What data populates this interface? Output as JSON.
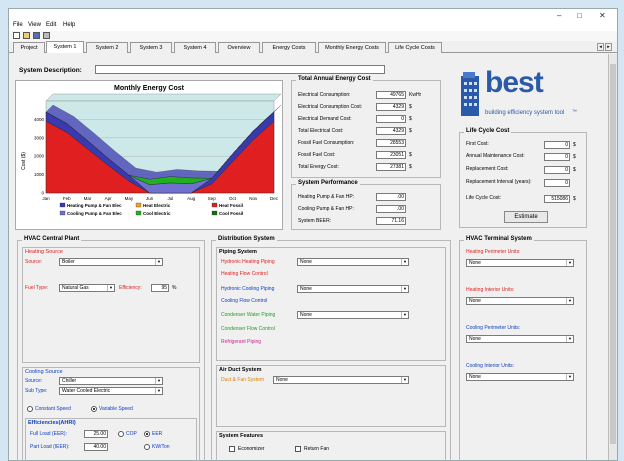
{
  "window": {
    "controls": [
      "–",
      "□",
      "✕"
    ]
  },
  "menu": [
    "File",
    "View",
    "Edit",
    "Help"
  ],
  "tabs": [
    "Project",
    "System 1",
    "System 2",
    "System 3",
    "System 4",
    "Overview",
    "Energy Costs",
    "Monthly Energy Costs",
    "Life Cycle Costs"
  ],
  "system_description_label": "System Description:",
  "chart": {
    "title": "Monthly Energy Cost",
    "ylabel": "Cost ($)",
    "yticks": [
      "4000",
      "3000",
      "2000",
      "1000",
      "0"
    ],
    "legend": [
      "Heating Pump & Fan Elec",
      "Heat Electric",
      "Heat Fossil",
      "Cooling Pump & Fan Elec",
      "Cool Electric",
      "Cool Fossil"
    ]
  },
  "chart_data": {
    "type": "area",
    "title": "Monthly Energy Cost",
    "ylabel": "Cost ($)",
    "ylim": [
      0,
      5000
    ],
    "categories": [
      "Jan",
      "Feb",
      "Mar",
      "Apr",
      "May",
      "Jun",
      "Jul",
      "Aug",
      "Sep",
      "Oct",
      "Nov",
      "Dec"
    ],
    "series": [
      {
        "name": "Heat Fossil",
        "values": [
          3900,
          3300,
          2400,
          1500,
          650,
          0,
          0,
          0,
          500,
          1700,
          2900,
          3900
        ],
        "color": "#e02020"
      },
      {
        "name": "Heating Pump & Fan Elec",
        "values": [
          500,
          480,
          450,
          380,
          320,
          0,
          0,
          0,
          300,
          420,
          470,
          500
        ],
        "color": "#3a3ab0"
      },
      {
        "name": "Cooling Pump & Fan Elec",
        "values": [
          0,
          0,
          0,
          0,
          0,
          450,
          550,
          500,
          0,
          0,
          0,
          0
        ],
        "color": "#7070d0"
      },
      {
        "name": "Cool Electric",
        "values": [
          0,
          0,
          0,
          0,
          0,
          300,
          350,
          320,
          0,
          0,
          0,
          0
        ],
        "color": "#20b020"
      }
    ],
    "backdrop_color": "#cde8e8"
  },
  "annual": {
    "title": "Total Annual Energy Cost",
    "rows": [
      {
        "label": "Electrical Consumption:",
        "value": "49765",
        "unit": "KwHr"
      },
      {
        "label": "Electrical Consumption Cost:",
        "value": "4329",
        "unit": "$"
      },
      {
        "label": "Electrical Demand Cost:",
        "value": "0",
        "unit": "$"
      },
      {
        "label": "Total Electrical Cost:",
        "value": "4329",
        "unit": "$"
      },
      {
        "label": "Fossil Fuel Consumption:",
        "value": "28553",
        "unit": ""
      },
      {
        "label": "Fossil Fuel Cost:",
        "value": "23051",
        "unit": "$"
      },
      {
        "label": "Total Energy Cost:",
        "value": "27381",
        "unit": "$"
      }
    ]
  },
  "performance": {
    "title": "System Performance",
    "rows": [
      {
        "label": "Heating Pump & Fan HP:",
        "value": ".00"
      },
      {
        "label": "Cooling Pump & Fan HP:",
        "value": ".00"
      },
      {
        "label": "System BEER:",
        "value": "71.16"
      }
    ]
  },
  "logo": {
    "word": "best",
    "tagline": "building efficiency system tool",
    "tm": "™"
  },
  "lcc": {
    "title": "Life Cycle Cost",
    "rows": [
      {
        "label": "First Cost:",
        "value": "0",
        "unit": "$"
      },
      {
        "label": "Annual Maintenance Cost:",
        "value": "0",
        "unit": "$"
      },
      {
        "label": "Replacement Cost:",
        "value": "0",
        "unit": "$"
      },
      {
        "label": "Replacement Interval (years):",
        "value": "0",
        "unit": ""
      },
      {
        "label": "Life Cycle Cost:",
        "value": "515086",
        "unit": "$"
      }
    ],
    "estimate_button": "Estimate"
  },
  "hvac_plant": {
    "title": "HVAC Central Plant",
    "heating_source_title": "Heating Source",
    "source_label": "Source:",
    "heating_source_value": "Boiler",
    "fuel_type_label": "Fuel Type:",
    "fuel_type_value": "Natural Gas",
    "efficiency_label": "Efficiency:",
    "efficiency_value": "95",
    "efficiency_unit": "%",
    "cooling_source_title": "Cooling Source",
    "cooling_source_value": "Chiller",
    "subtype_label": "Sub Type:",
    "subtype_value": "Water Cooled Electric",
    "constant_speed": "Constant Speed",
    "variable_speed": "Variable Speed",
    "efficiencies_title": "Efficiencies(AHRI)",
    "full_load_label": "Full Load (EER):",
    "full_load_value": "25.00",
    "part_load_label": "Part Load (IEER):",
    "part_load_value": "40.00",
    "cop": "COP",
    "eer": "EER",
    "kwton": "KW/Ton"
  },
  "distribution": {
    "title": "Distribution System",
    "piping_title": "Piping System",
    "hydronic_heating": "Hydronic Heating Piping",
    "heating_flow": "Heating Flow Control",
    "hydronic_cooling": "Hydronic Cooling Piping",
    "cooling_flow": "Cooling Flow Control",
    "condenser_water": "Condenser Water Piping",
    "condenser_flow": "Condenser Flow Control",
    "refrigerant": "Refrigerant Piping",
    "none": "None",
    "air_duct_title": "Air Duct System",
    "duct_fan": "Duct & Fan System",
    "features_title": "System Features",
    "economizer": "Economizer",
    "return_fan": "Return Fan"
  },
  "terminal": {
    "title": "HVAC Terminal System",
    "heating_perimeter": "Heating Perimeter Units:",
    "heating_interior": "Heating Interior Units:",
    "cooling_perimeter": "Cooling Perimeter Units:",
    "cooling_interior": "Cooling Interior Units:",
    "none": "None"
  }
}
